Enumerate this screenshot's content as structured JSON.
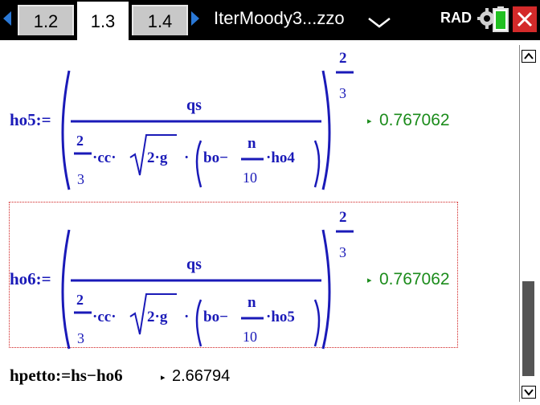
{
  "tabs": [
    {
      "label": "1.2",
      "active": false
    },
    {
      "label": "1.3",
      "active": true
    },
    {
      "label": "1.4",
      "active": false
    }
  ],
  "document_title": "IterMoody3...zzo",
  "angle_mode": "RAD",
  "colors": {
    "math": "#1a1ab8",
    "result": "#1c8c1c",
    "selection": "#d02020",
    "close": "#d42a2a"
  },
  "entries": [
    {
      "lhs": "ho5:=",
      "numerator": "qs",
      "coef_num": "2",
      "coef_den": "3",
      "cc": "·cc·",
      "sqrt_body": "2·g",
      "dot": "·",
      "bo": "bo−",
      "frac_n": "n",
      "frac_10": "10",
      "tail": "·ho4",
      "exp_num": "2",
      "exp_den": "3",
      "result": "0.767062"
    },
    {
      "lhs": "ho6:=",
      "numerator": "qs",
      "coef_num": "2",
      "coef_den": "3",
      "cc": "·cc·",
      "sqrt_body": "2·g",
      "dot": "·",
      "bo": "bo−",
      "frac_n": "n",
      "frac_10": "10",
      "tail": "·ho5",
      "exp_num": "2",
      "exp_den": "3",
      "result": "0.767062"
    }
  ],
  "last_entry": {
    "expr": "hpetto:=hs−ho6",
    "result": "2.66794"
  },
  "result_marker": "▸"
}
